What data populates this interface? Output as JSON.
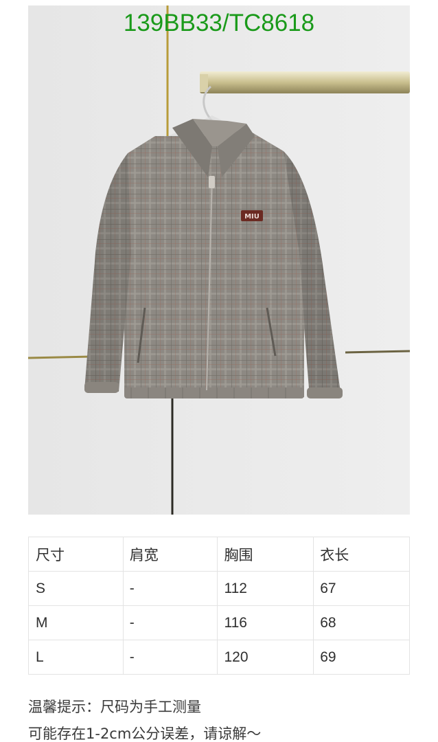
{
  "product": {
    "code": "139BB33/TC8618"
  },
  "size_table": {
    "header": [
      "尺寸",
      "肩宽",
      "胸围",
      "衣长"
    ],
    "rows": [
      [
        "S",
        "-",
        "112",
        "67"
      ],
      [
        "M",
        "-",
        "116",
        "68"
      ],
      [
        "L",
        "-",
        "120",
        "69"
      ]
    ]
  },
  "notes": {
    "line1": "温馨提示：尺码为手工测量",
    "line2": "可能存在1-2cm公分误差，请谅解～"
  },
  "colors": {
    "code_text": "#1a9a1a",
    "jacket": "#8a8680",
    "wall": "#e9e9e9",
    "logo": "#6b2a22"
  }
}
